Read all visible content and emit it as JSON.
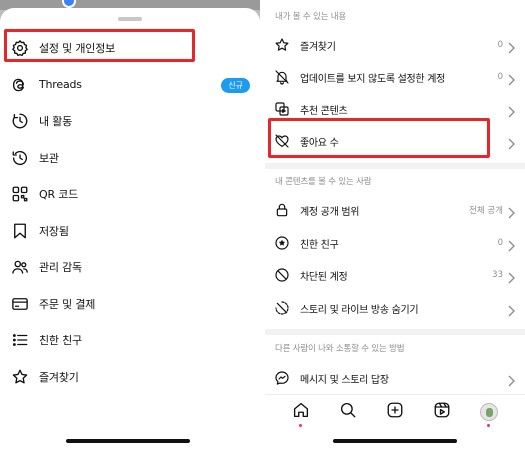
{
  "colors": {
    "highlight": "#e8262a",
    "badge": "#1d9bf0",
    "notification_dot": "#ff2d55",
    "secondary_text": "#8e8e8e"
  },
  "left_menu": {
    "items": [
      {
        "label": "설정 및 개인정보",
        "icon": "settings-gear-icon"
      },
      {
        "label": "Threads",
        "icon": "threads-icon",
        "badge": "신규"
      },
      {
        "label": "내 활동",
        "icon": "activity-clock-icon"
      },
      {
        "label": "보관",
        "icon": "archive-history-icon"
      },
      {
        "label": "QR 코드",
        "icon": "qr-code-icon"
      },
      {
        "label": "저장됨",
        "icon": "bookmark-icon"
      },
      {
        "label": "관리 감독",
        "icon": "supervision-icon"
      },
      {
        "label": "주문 및 결제",
        "icon": "credit-card-icon"
      },
      {
        "label": "친한 친구",
        "icon": "close-friends-list-icon"
      },
      {
        "label": "즐겨찾기",
        "icon": "star-icon"
      }
    ],
    "highlighted_item": "설정 및 개인정보"
  },
  "right_settings": {
    "section_what_you_see": "내가 볼 수 있는 내용",
    "items_what_you_see": [
      {
        "label": "즐겨찾기",
        "value": "0",
        "icon": "star-icon"
      },
      {
        "label": "업데이트를 보지 않도록 설정한 계정",
        "value": "0",
        "icon": "muted-bell-icon"
      },
      {
        "label": "추천 콘텐츠",
        "value": "",
        "icon": "suggested-content-icon"
      },
      {
        "label": "좋아요 수",
        "value": "",
        "icon": "hidden-like-heart-icon"
      }
    ],
    "section_who_can_see": "내 콘텐츠를 볼 수 있는 사람",
    "items_who_can_see": [
      {
        "label": "계정 공개 범위",
        "value": "전체 공개",
        "icon": "lock-icon"
      },
      {
        "label": "친한 친구",
        "value": "0",
        "icon": "close-friends-star-icon"
      },
      {
        "label": "차단된 계정",
        "value": "33",
        "icon": "blocked-icon"
      },
      {
        "label": "스토리 및 라이브 방송 숨기기",
        "value": "",
        "icon": "hide-story-icon"
      }
    ],
    "section_interaction": "다른 사람이 나와 소통할 수 있는 방법",
    "items_interaction": [
      {
        "label": "메시지 및 스토리 답장",
        "value": "",
        "icon": "messenger-icon"
      }
    ],
    "highlighted_item": "좋아요 수"
  },
  "tab_bar": {
    "tabs": [
      {
        "name": "home",
        "icon": "home-icon",
        "dot": true
      },
      {
        "name": "search",
        "icon": "search-icon",
        "dot": false
      },
      {
        "name": "create",
        "icon": "plus-square-icon",
        "dot": false
      },
      {
        "name": "reels",
        "icon": "reels-icon",
        "dot": false
      },
      {
        "name": "profile",
        "icon": "profile-avatar",
        "dot": true
      }
    ]
  }
}
